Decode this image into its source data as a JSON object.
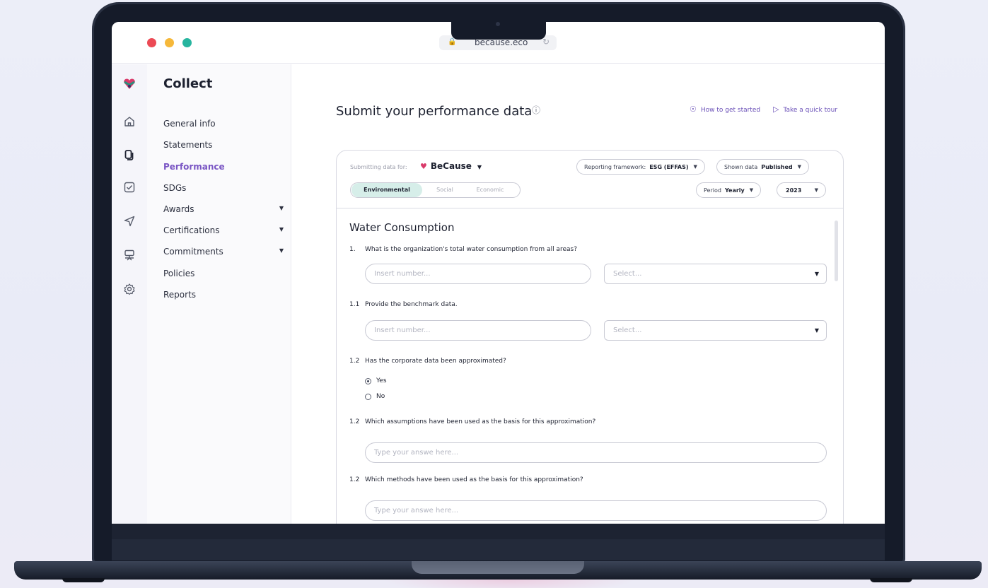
{
  "browser": {
    "url": "because.eco"
  },
  "sidebar": {
    "title": "Collect",
    "items": [
      {
        "label": "General info"
      },
      {
        "label": "Statements"
      },
      {
        "label": "Performance"
      },
      {
        "label": "SDGs"
      },
      {
        "label": "Awards"
      },
      {
        "label": "Certifications"
      },
      {
        "label": "Commitments"
      },
      {
        "label": "Policies"
      },
      {
        "label": "Reports"
      }
    ]
  },
  "rail": {
    "icons": [
      "logo-icon",
      "home-icon",
      "collect-icon",
      "checkbox-icon",
      "send-icon",
      "presentation-icon",
      "settings-icon"
    ]
  },
  "header": {
    "title": "Submit your performance data",
    "help_link": "How to get started",
    "tour_link": "Take a quick tour"
  },
  "filters": {
    "submitting_label": "Submitting data for:",
    "organization": "BeCause",
    "framework_label": "Reporting framework:",
    "framework_value": "ESG (EFFAS)",
    "shown_label": "Shown data",
    "shown_value": "Published",
    "period_label": "Period",
    "period_value": "Yearly",
    "year": "2023",
    "tabs": [
      {
        "label": "Environmental"
      },
      {
        "label": "Social"
      },
      {
        "label": "Economic"
      }
    ]
  },
  "form": {
    "section_title": "Water Consumption",
    "questions": [
      {
        "num": "1.",
        "text": "What is the organization's total water consumption from all areas?"
      },
      {
        "num": "1.1",
        "text": "Provide the benchmark data."
      },
      {
        "num": "1.2",
        "text": "Has the corporate data been approximated?"
      },
      {
        "num": "1.2",
        "text": "Which assumptions have been used as the basis for this approximation?"
      },
      {
        "num": "1.2",
        "text": "Which methods have been used as the basis for this approximation?"
      }
    ],
    "number_placeholder": "Insert number...",
    "select_placeholder": "Select...",
    "answer_placeholder": "Type your answe here...",
    "radio_options": [
      {
        "label": "Yes",
        "selected": true
      },
      {
        "label": "No",
        "selected": false
      }
    ]
  },
  "colors": {
    "accent": "#7a56c4",
    "tab_active_bg": "#d6eee9",
    "traffic_red": "#ec4a55",
    "traffic_yellow": "#f6b83a",
    "traffic_green": "#27b59f"
  }
}
